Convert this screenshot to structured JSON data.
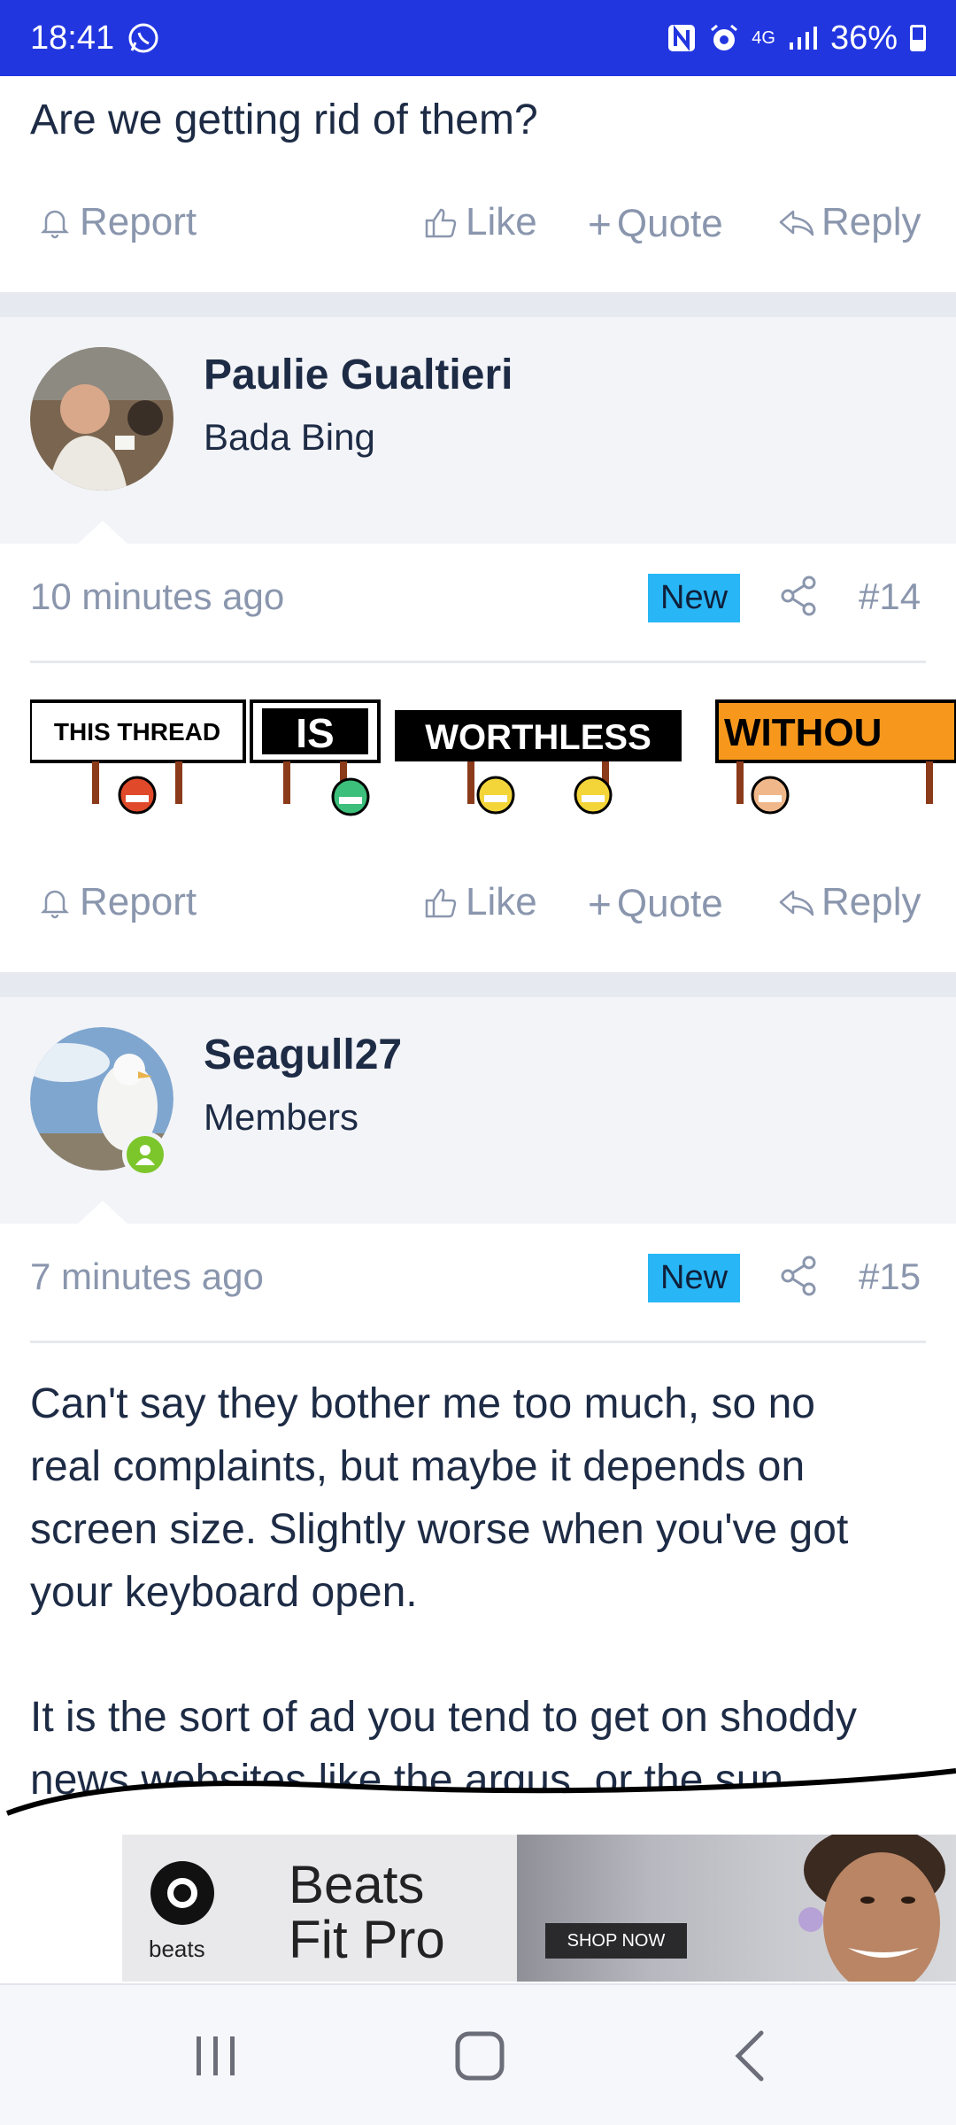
{
  "status_bar": {
    "time": "18:41",
    "battery": "36%",
    "network": "4G",
    "icons": [
      "whatsapp-icon",
      "nfc-icon",
      "alarm-icon",
      "signal-icon",
      "battery-icon"
    ]
  },
  "previous_post": {
    "text_tail": "Are we getting rid of them?"
  },
  "actions": {
    "report": "Report",
    "like": "Like",
    "quote": "Quote",
    "reply": "Reply"
  },
  "posts": [
    {
      "author": "Paulie Gualtieri",
      "user_title": "Bada Bing",
      "time": "10 minutes ago",
      "badge": "New",
      "number": "#14",
      "image_text": [
        "THIS THREAD",
        "IS",
        "WORTHLESS",
        "WITHOU"
      ]
    },
    {
      "author": "Seagull27",
      "user_title": "Members",
      "time": "7 minutes ago",
      "badge": "New",
      "number": "#15",
      "paragraphs": [
        [
          "Can't say they bother me too much, so no",
          "real complaints, but maybe it depends on",
          "screen size. Slightly worse when you've got",
          "your keyboard open."
        ],
        [
          "It is the sort of ad you tend to get on shoddy",
          "news websites like the argus, or the sun,"
        ]
      ]
    }
  ],
  "ad": {
    "brand_small": "beats",
    "headline_1": "Beats",
    "headline_2": "Fit Pro",
    "cta": "SHOP NOW"
  },
  "colors": {
    "status_bar": "#2236e0",
    "badge": "#29b6f6",
    "muted": "#8a96ad",
    "text": "#1d2b45",
    "online": "#7cc62b"
  }
}
